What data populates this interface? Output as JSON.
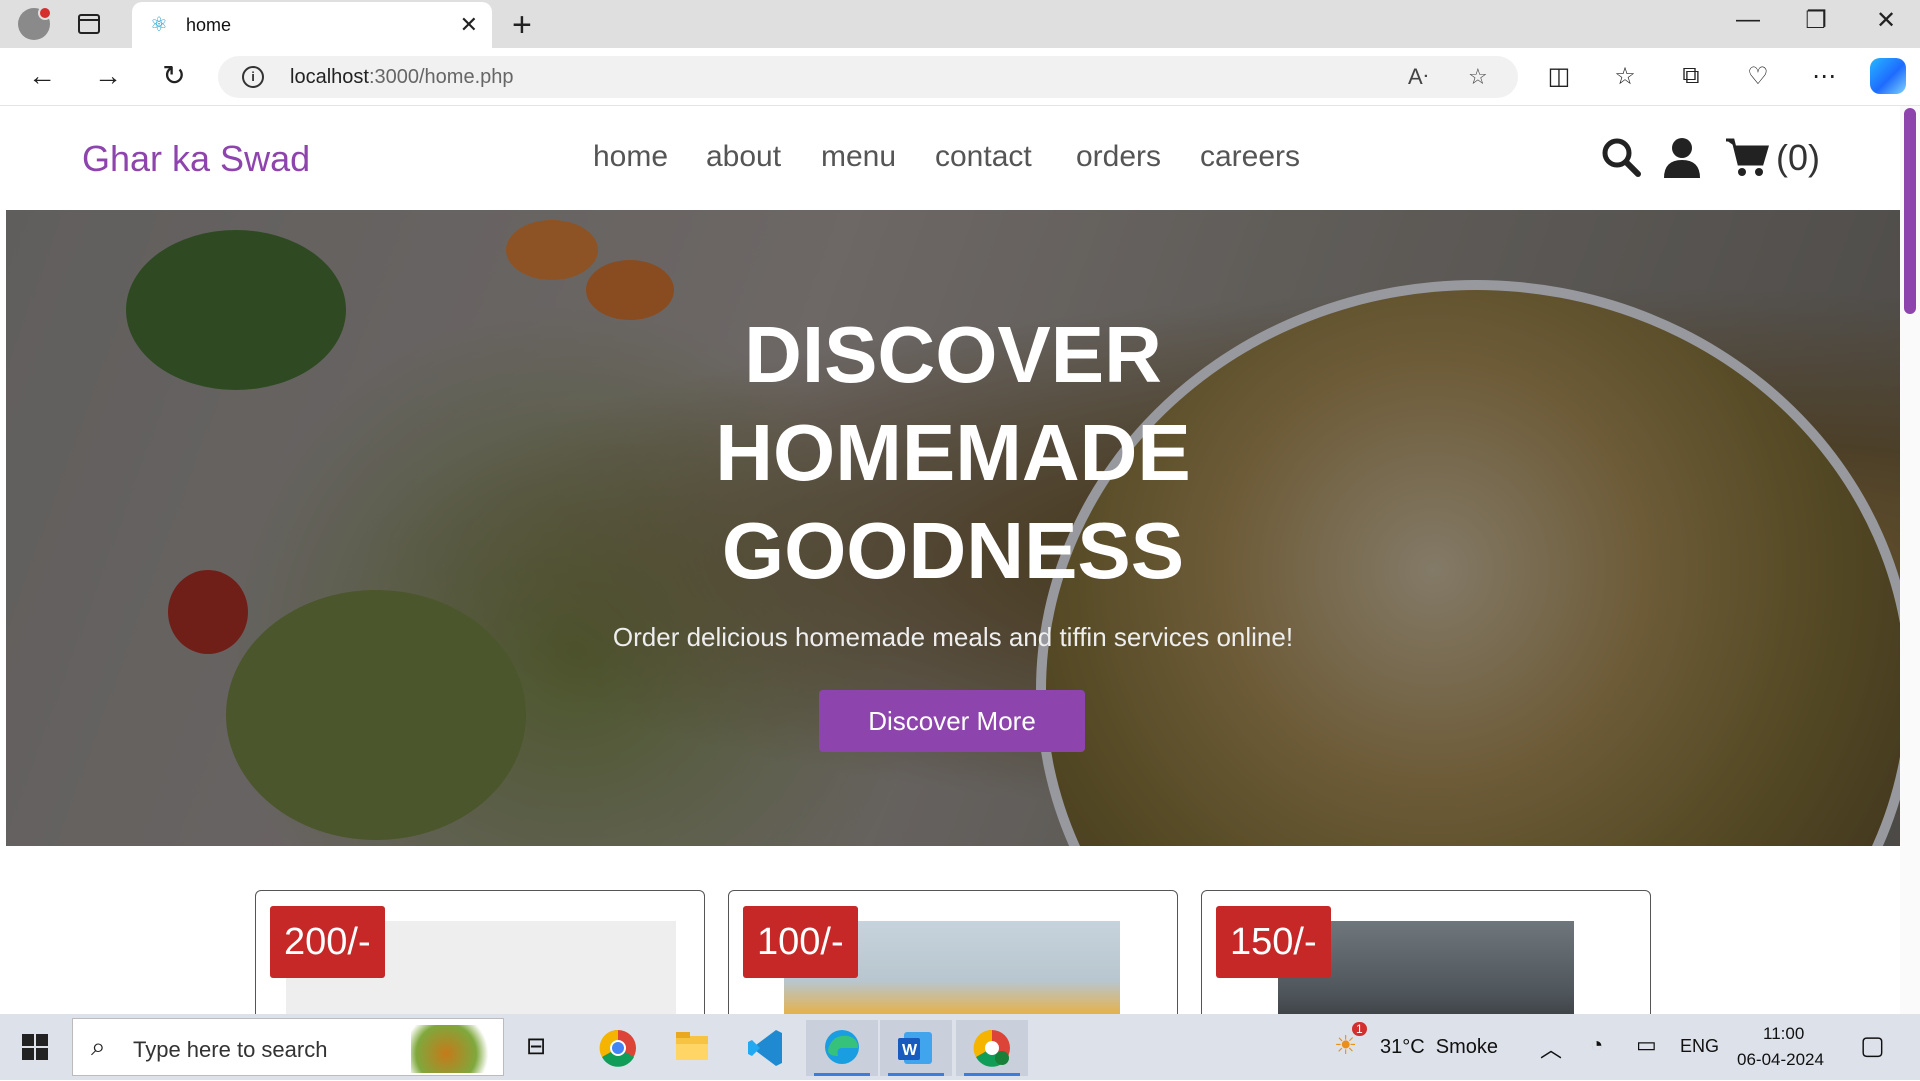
{
  "browser": {
    "tab_title": "home",
    "url_host": "localhost",
    "url_path": ":3000/home.php"
  },
  "site": {
    "logo": "Ghar ka Swad",
    "nav": [
      "home",
      "about",
      "menu",
      "contact",
      "orders",
      "careers"
    ],
    "cart_count": "(0)"
  },
  "hero": {
    "title_lines": [
      "DISCOVER",
      "HOMEMADE",
      "GOODNESS"
    ],
    "subtitle": "Order delicious homemade meals and tiffin services online!",
    "button": "Discover More"
  },
  "products": [
    {
      "price": "200/-"
    },
    {
      "price": "100/-"
    },
    {
      "price": "150/-"
    }
  ],
  "taskbar": {
    "search_placeholder": "Type here to search",
    "weather": "31°C  Smoke",
    "weather_badge": "1",
    "language": "ENG",
    "time": "11:00",
    "date": "06-04-2024"
  },
  "colors": {
    "brand": "#8e44ad",
    "price_badge": "#c62828"
  }
}
